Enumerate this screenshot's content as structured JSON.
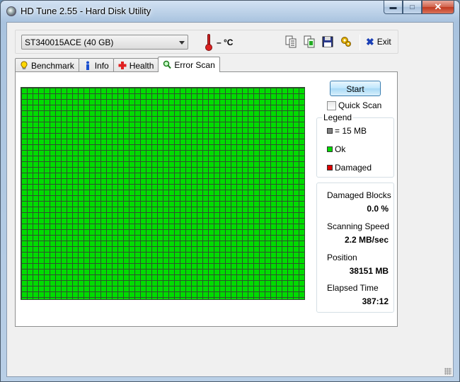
{
  "window": {
    "title": "HD Tune 2.55 - Hard Disk Utility"
  },
  "toolbar": {
    "drive": "ST340015ACE (40 GB)",
    "temperature": "– °C",
    "exit_label": "Exit",
    "icons": [
      "copy-text-icon",
      "copy-screenshot-icon",
      "save-icon",
      "options-icon"
    ]
  },
  "tabs": [
    {
      "label": "Benchmark",
      "icon": "benchmark-icon"
    },
    {
      "label": "Info",
      "icon": "info-icon"
    },
    {
      "label": "Health",
      "icon": "health-icon"
    },
    {
      "label": "Error Scan",
      "icon": "error-scan-icon",
      "active": true
    }
  ],
  "error_scan": {
    "start_label": "Start",
    "quick_scan_label": "Quick Scan",
    "quick_scan_checked": false,
    "legend": {
      "title": "Legend",
      "items": [
        {
          "label": "= 15 MB",
          "color": "#808080"
        },
        {
          "label": "Ok",
          "color": "#00dc00"
        },
        {
          "label": "Damaged",
          "color": "#e00000"
        }
      ]
    },
    "stats": {
      "damaged_blocks_label": "Damaged Blocks",
      "damaged_blocks": "0.0 %",
      "speed_label": "Scanning Speed",
      "speed": "2.2 MB/sec",
      "position_label": "Position",
      "position": "38151 MB",
      "elapsed_label": "Elapsed Time",
      "elapsed": "387:12"
    }
  },
  "colors": {
    "ok": "#00dc00",
    "grid_line": "#2f4f2f",
    "damaged": "#e00000"
  }
}
